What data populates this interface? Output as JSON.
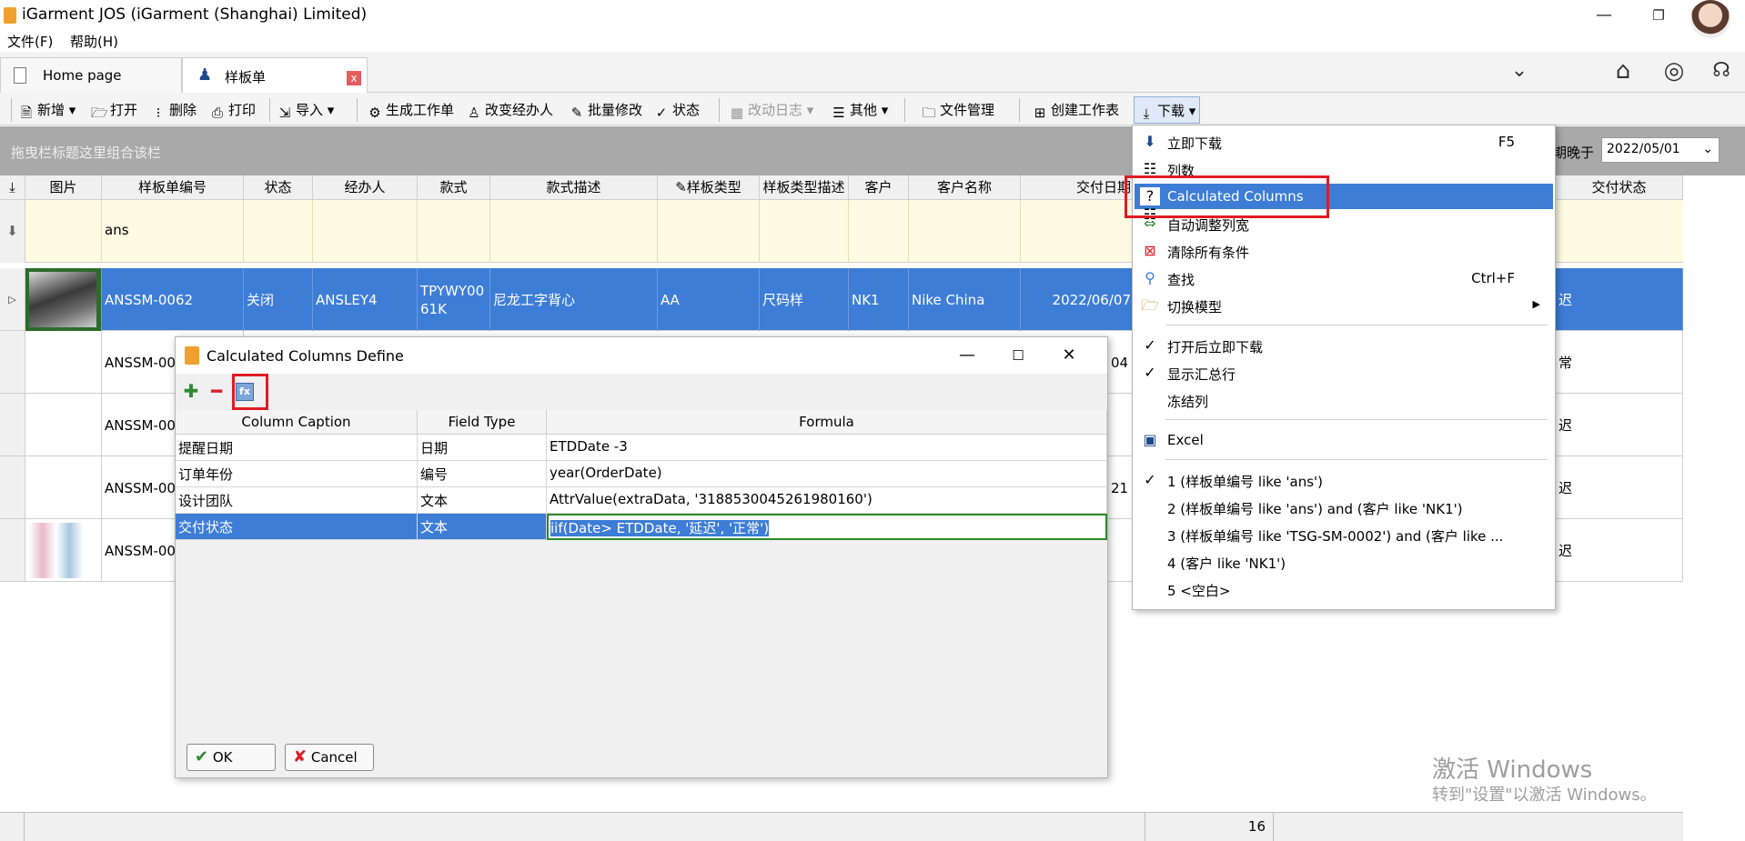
{
  "window": {
    "title": "iGarment JOS (iGarment (Shanghai) Limited)"
  },
  "menubar": {
    "file": "文件(F)",
    "help": "帮助(H)"
  },
  "tabs": [
    {
      "label": "Home page"
    },
    {
      "label": "样板单",
      "close": "x"
    }
  ],
  "toolbar": {
    "add": "新增",
    "open": "打开",
    "delete": "删除",
    "print": "打印",
    "import": "导入",
    "gen_order": "生成工作单",
    "change_handler": "改变经办人",
    "batch_edit": "批量修改",
    "status": "状态",
    "change_log": "改动日志",
    "other": "其他",
    "file_mgmt": "文件管理",
    "create_sheet": "创建工作表",
    "download": "下载"
  },
  "groupbar": {
    "hint": "拖曳栏标题这里组合该栏",
    "date_label": "期晚于",
    "date_value": "2022/05/01"
  },
  "grid": {
    "headers": [
      "图片",
      "样板单编号",
      "状态",
      "经办人",
      "款式",
      "款式描述",
      "样板类型",
      "样板类型描述",
      "客户",
      "客户名称",
      "交付日期",
      "交付状态"
    ],
    "filter_value": "ans",
    "rows": [
      {
        "no": "ANSSM-0062",
        "status": "关闭",
        "handler": "ANSLEY4",
        "style": "TPYWY0061K",
        "style_line1": "TPYWY00",
        "style_line2": "61K",
        "desc": "尼龙工字背心",
        "type": "AA",
        "type_desc": "尺码样",
        "customer": "NK1",
        "cust_name": "Nike China",
        "date": "2022/06/07",
        "delivery": "迟"
      },
      {
        "no": "ANSSM-00",
        "date_tail": "04",
        "delivery": "常"
      },
      {
        "no": "ANSSM-00",
        "delivery": "迟"
      },
      {
        "no": "ANSSM-00",
        "date_tail": "21",
        "delivery": "迟"
      },
      {
        "no": "ANSSM-00",
        "delivery": "迟"
      }
    ]
  },
  "status_count": "16",
  "dropdown": {
    "items": [
      {
        "label": "立即下载",
        "shortcut": "F5"
      },
      {
        "label": "列数"
      },
      {
        "label": "Calculated Columns"
      },
      {
        "label": "自动调整列宽"
      },
      {
        "label": "清除所有条件"
      },
      {
        "label": "查找",
        "shortcut": "Ctrl+F"
      },
      {
        "label": "切换模型"
      },
      {
        "label": "打开后立即下载"
      },
      {
        "label": "显示汇总行"
      },
      {
        "label": "冻结列"
      },
      {
        "label": "Excel"
      },
      {
        "label": "1 (样板单编号 like 'ans')"
      },
      {
        "label": "2 (样板单编号 like 'ans') and (客户 like 'NK1')"
      },
      {
        "label": "3 (样板单编号 like 'TSG-SM-0002') and (客户 like ..."
      },
      {
        "label": "4 (客户 like 'NK1')"
      },
      {
        "label": "5 <空白>"
      }
    ]
  },
  "dialog": {
    "title": "Calculated Columns Define",
    "headers": [
      "Column Caption",
      "Field Type",
      "Formula"
    ],
    "rows": [
      {
        "caption": "提醒日期",
        "type": "日期",
        "formula": "ETDDate -3"
      },
      {
        "caption": "订单年份",
        "type": "编号",
        "formula": "year(OrderDate)"
      },
      {
        "caption": "设计团队",
        "type": "文本",
        "formula": "AttrValue(extraData, '3188530045261980160')"
      },
      {
        "caption": "交付状态",
        "type": "文本",
        "formula": "iif(Date> ETDDate, '延迟', '正常')"
      }
    ],
    "ok": "OK",
    "cancel": "Cancel"
  },
  "watermark": {
    "line1": "激活 Windows",
    "line2": "转到\"设置\"以激活 Windows。"
  },
  "colors": {
    "selection": "#3d7dd6",
    "highlight_box": "#e01b24",
    "filter_row": "#fdfbe2"
  }
}
